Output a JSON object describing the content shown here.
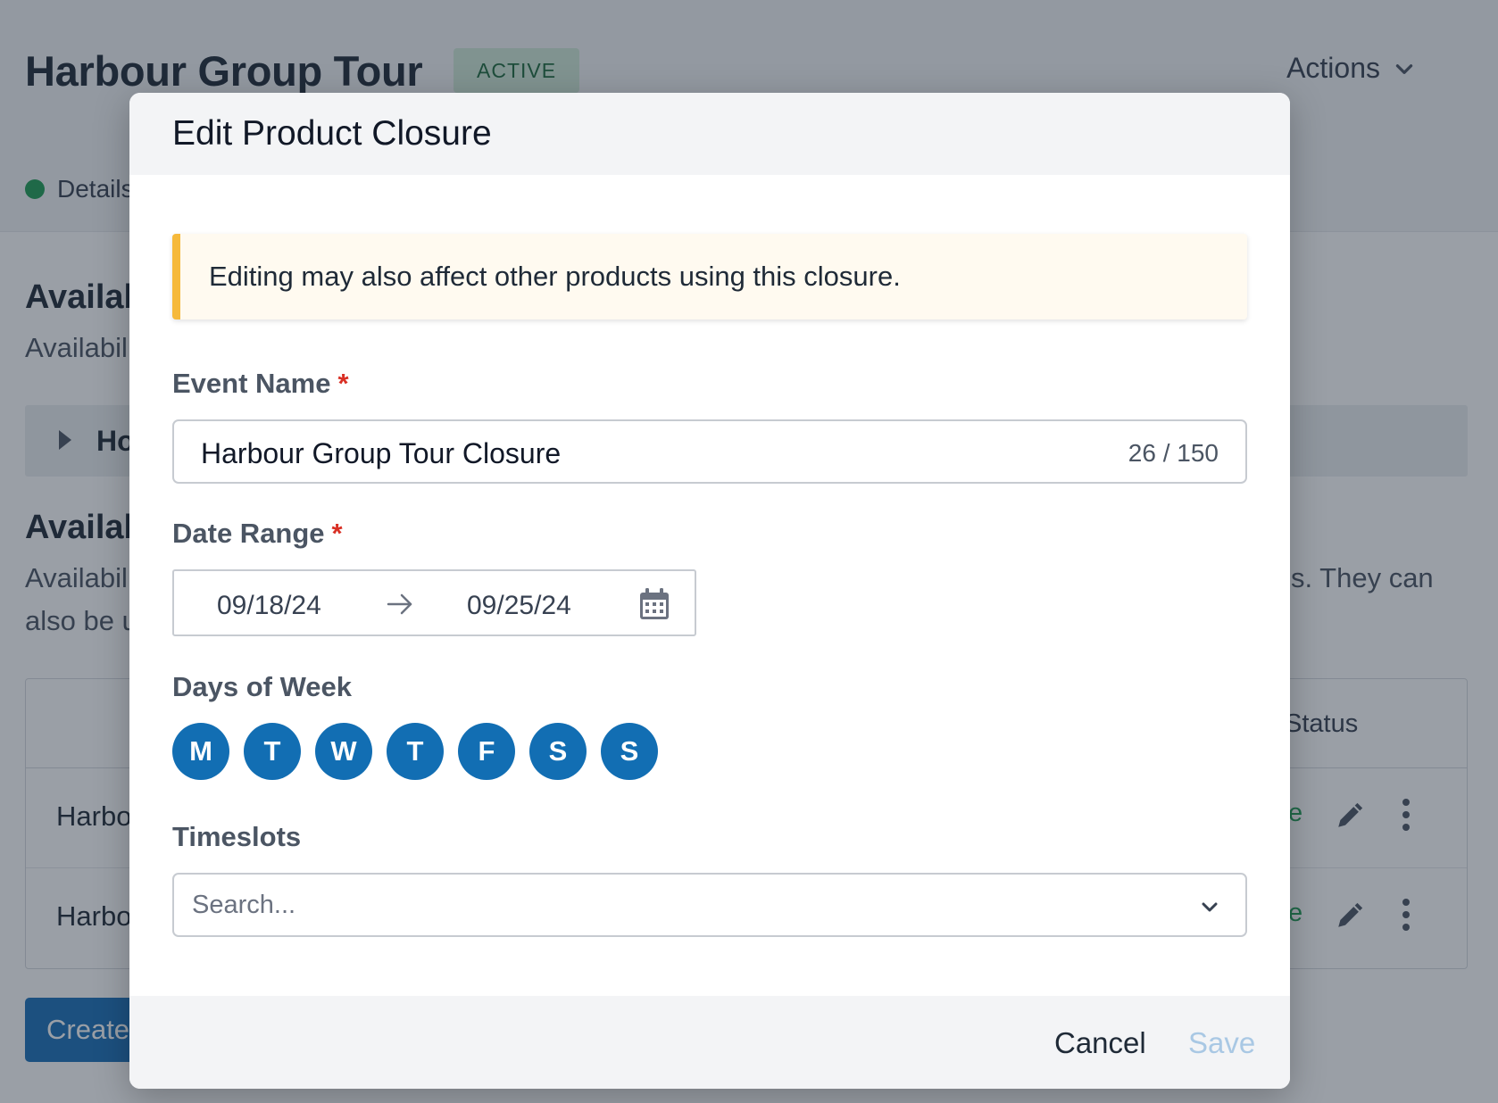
{
  "page": {
    "title": "Harbour Group Tour",
    "status_badge": "ACTIVE",
    "actions_label": "Actions",
    "nav_tab_details": "Details",
    "section1_title": "Availab",
    "section1_desc": "Availabil",
    "collapsible_label": "Ho",
    "section2_title": "Availab",
    "section2_desc_line1_left": "Availabil",
    "section2_desc_line1_right": "s. They can",
    "section2_desc_line2": "also be u",
    "table": {
      "status_header": "Status",
      "rows": [
        {
          "name": "Harbo",
          "status": "e"
        },
        {
          "name": "Harbo",
          "status": "e"
        }
      ]
    },
    "create_button": "Create"
  },
  "modal": {
    "title": "Edit Product Closure",
    "alert_text": "Editing may also affect other products using this closure.",
    "event_name": {
      "label": "Event Name",
      "required_mark": "*",
      "value": "Harbour Group Tour Closure",
      "counter": "26 / 150"
    },
    "date_range": {
      "label": "Date Range",
      "required_mark": "*",
      "start": "09/18/24",
      "end": "09/25/24"
    },
    "days_of_week": {
      "label": "Days of Week",
      "days": [
        "M",
        "T",
        "W",
        "T",
        "F",
        "S",
        "S"
      ]
    },
    "timeslots": {
      "label": "Timeslots",
      "placeholder": "Search..."
    },
    "footer": {
      "cancel_label": "Cancel",
      "save_label": "Save"
    }
  },
  "colors": {
    "primary": "#126eb3",
    "warning_accent": "#f6b93b",
    "active_badge_bg": "#cfe9d8",
    "required": "#d93025",
    "save_disabled": "#a9c8e4"
  }
}
